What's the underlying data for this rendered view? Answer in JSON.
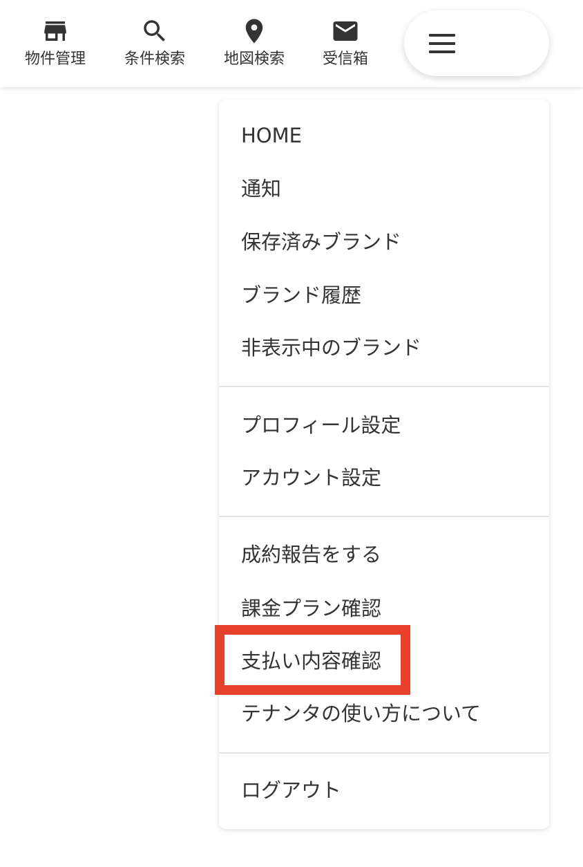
{
  "topnav": {
    "items": [
      {
        "label": "物件管理",
        "icon": "store-icon"
      },
      {
        "label": "条件検索",
        "icon": "search-icon"
      },
      {
        "label": "地図検索",
        "icon": "map-pin-icon"
      },
      {
        "label": "受信箱",
        "icon": "mail-icon"
      }
    ],
    "menu_icon": "hamburger-icon"
  },
  "menu": {
    "sections": [
      {
        "items": [
          "HOME",
          "通知",
          "保存済みブランド",
          "ブランド履歴",
          "非表示中のブランド"
        ]
      },
      {
        "items": [
          "プロフィール設定",
          "アカウント設定"
        ]
      },
      {
        "items": [
          "成約報告をする",
          "課金プラン確認",
          "支払い内容確認",
          "テナンタの使い方について"
        ]
      },
      {
        "items": [
          "ログアウト"
        ]
      }
    ],
    "highlighted_item": "支払い内容確認"
  },
  "colors": {
    "text": "#333333",
    "highlight_border": "#e8412b",
    "divider": "#e3e3e3"
  }
}
